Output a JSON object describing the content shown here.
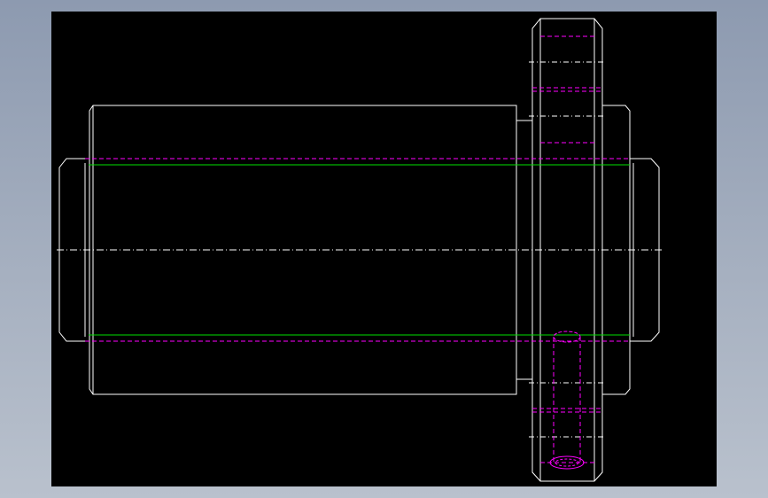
{
  "viewport": {
    "background_top": "#8d9ab0",
    "background_bottom": "#b9c1cd",
    "drawing_background": "#000000"
  },
  "colors": {
    "outline": "#ffffff",
    "hidden_line": "#ff00ff",
    "pitch_line": "#00e000",
    "center_line": "#ffffff"
  },
  "drawing": {
    "type": "cad-orthographic-view",
    "parts": [
      "shaft",
      "sleeve",
      "gear",
      "pin-hole"
    ]
  }
}
